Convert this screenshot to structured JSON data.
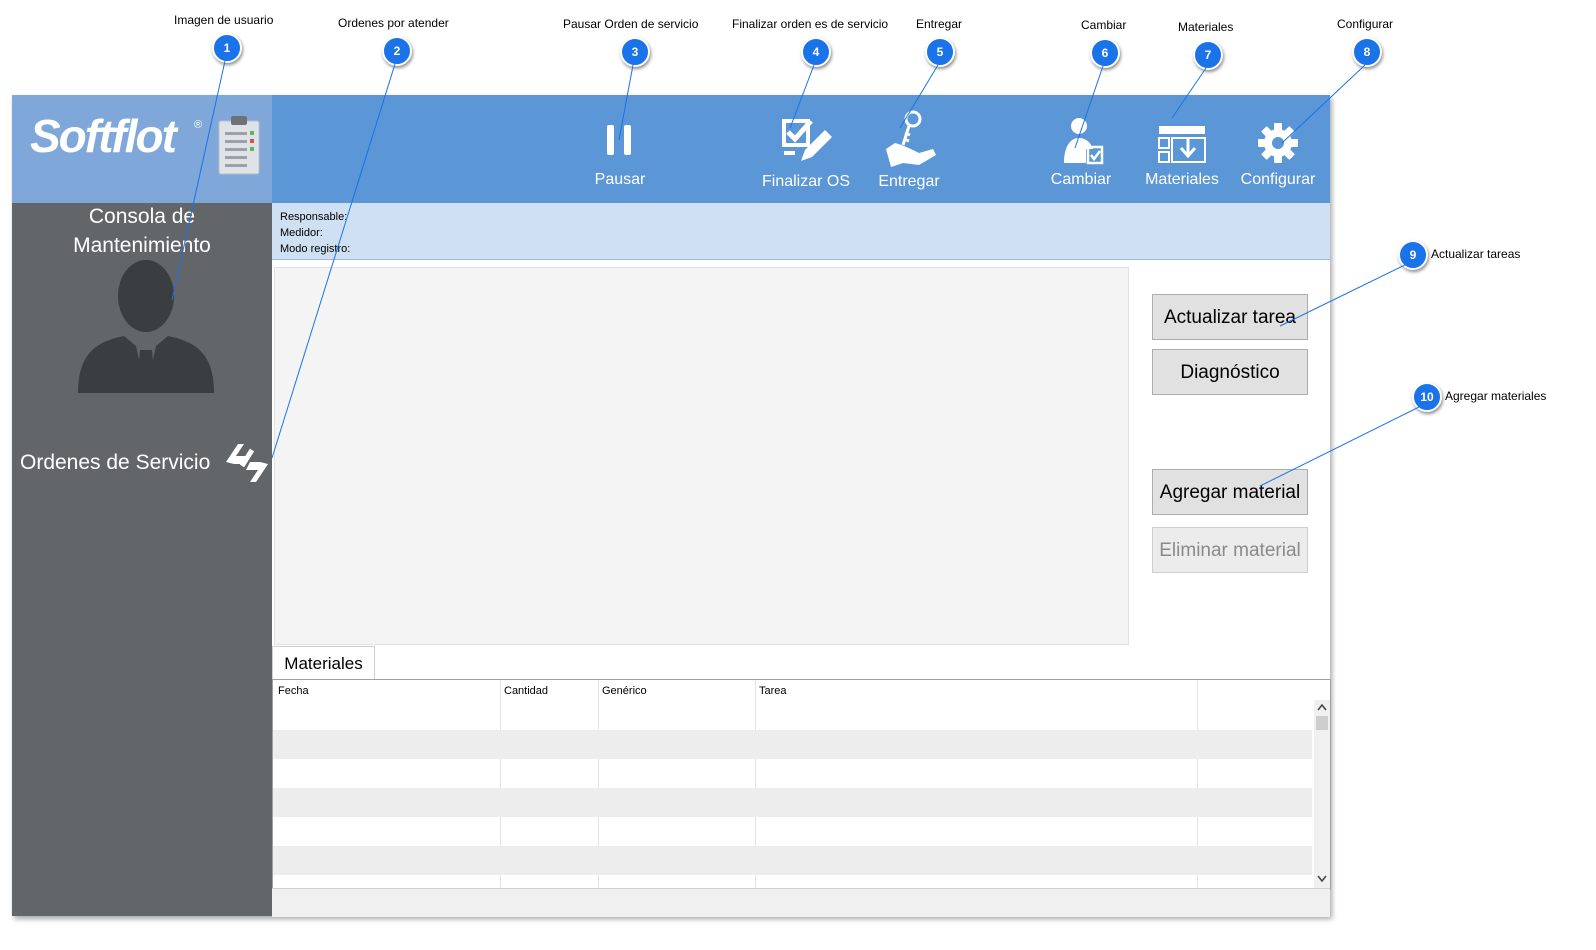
{
  "annotations": [
    {
      "num": "1",
      "label": "Imagen de usuario"
    },
    {
      "num": "2",
      "label": "Ordenes por atender"
    },
    {
      "num": "3",
      "label": "Pausar Orden de servicio"
    },
    {
      "num": "4",
      "label": "Finalizar orden es de servicio"
    },
    {
      "num": "5",
      "label": "Entregar"
    },
    {
      "num": "6",
      "label": "Cambiar"
    },
    {
      "num": "7",
      "label": "Materiales"
    },
    {
      "num": "8",
      "label": "Configurar"
    },
    {
      "num": "9",
      "label": "Actualizar tareas"
    },
    {
      "num": "10",
      "label": "Agregar materiales"
    }
  ],
  "app": {
    "logo_text": "Softflot",
    "logo_mark": "®",
    "console_title_line1": "Consola de",
    "console_title_line2": "Mantenimiento",
    "orders_label": "Ordenes de Servicio"
  },
  "toolbar": {
    "pause": "Pausar",
    "finish": "Finalizar OS",
    "deliver": "Entregar",
    "change": "Cambiar",
    "materials": "Materiales",
    "configure": "Configurar"
  },
  "info": {
    "responsible": "Responsable:",
    "meter": "Medidor:",
    "mode": "Modo registro:"
  },
  "buttons": {
    "update_task": "Actualizar tarea",
    "diagnostic": "Diagnóstico",
    "add_material": "Agregar material",
    "delete_material": "Eliminar material"
  },
  "materials": {
    "tab": "Materiales",
    "columns": [
      "Fecha",
      "Cantidad",
      "Genérico",
      "Tarea"
    ]
  },
  "colors": {
    "toolbar": "#5b96d6",
    "logo_area": "#7fa7d9",
    "sidebar": "#626669",
    "info_bar": "#cfe0f3",
    "badge": "#1a73e8"
  }
}
